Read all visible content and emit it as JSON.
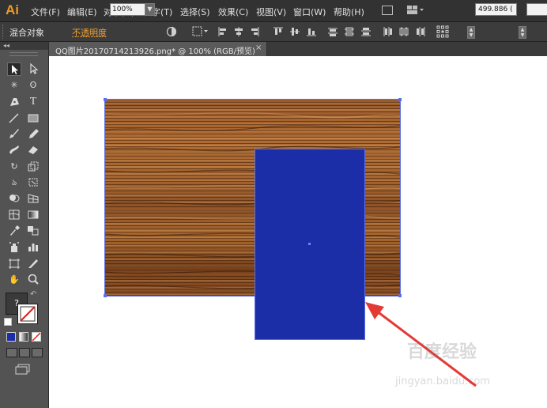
{
  "app": {
    "logo": "Ai"
  },
  "menubar": {
    "items": [
      {
        "label": "文件(F)",
        "name": "menu-file"
      },
      {
        "label": "编辑(E)",
        "name": "menu-edit"
      },
      {
        "label": "对象(O)",
        "name": "menu-object"
      },
      {
        "label": "文字(T)",
        "name": "menu-type"
      },
      {
        "label": "选择(S)",
        "name": "menu-select"
      },
      {
        "label": "效果(C)",
        "name": "menu-effect"
      },
      {
        "label": "视图(V)",
        "name": "menu-view"
      },
      {
        "label": "窗口(W)",
        "name": "menu-window"
      },
      {
        "label": "帮助(H)",
        "name": "menu-help"
      }
    ]
  },
  "controlbar": {
    "selection_label": "混合对象",
    "opacity_label": "不透明度",
    "opacity_value": "100%",
    "x_value": "499.886 (",
    "opacity_label_color": "#f0a030"
  },
  "document": {
    "tab_title": "QQ图片20170714213926.png* @ 100% (RGB/预览)",
    "tab_close": "×"
  },
  "canvas": {
    "artwork_texture": "wood-planks",
    "rectangle_fill": "#1c2da8",
    "selection_color": "#5b6fe8",
    "annotation_arrow_color": "#e53935"
  },
  "tools": {
    "icons": [
      "selection-tool",
      "direct-selection-tool",
      "magic-wand-tool",
      "lasso-tool",
      "pen-tool",
      "type-tool",
      "line-tool",
      "rectangle-tool",
      "paintbrush-tool",
      "pencil-tool",
      "blob-brush-tool",
      "eraser-tool",
      "rotate-tool",
      "scale-tool",
      "warp-tool",
      "free-transform-tool",
      "shape-builder-tool",
      "perspective-grid-tool",
      "mesh-tool",
      "gradient-tool",
      "eyedropper-tool",
      "blend-tool",
      "symbol-sprayer-tool",
      "column-graph-tool",
      "artboard-tool",
      "slice-tool",
      "hand-tool",
      "zoom-tool"
    ],
    "fill_stroke_help": "?"
  },
  "watermark": {
    "text": "百度经验",
    "url": "jingyan.baidu.com"
  }
}
